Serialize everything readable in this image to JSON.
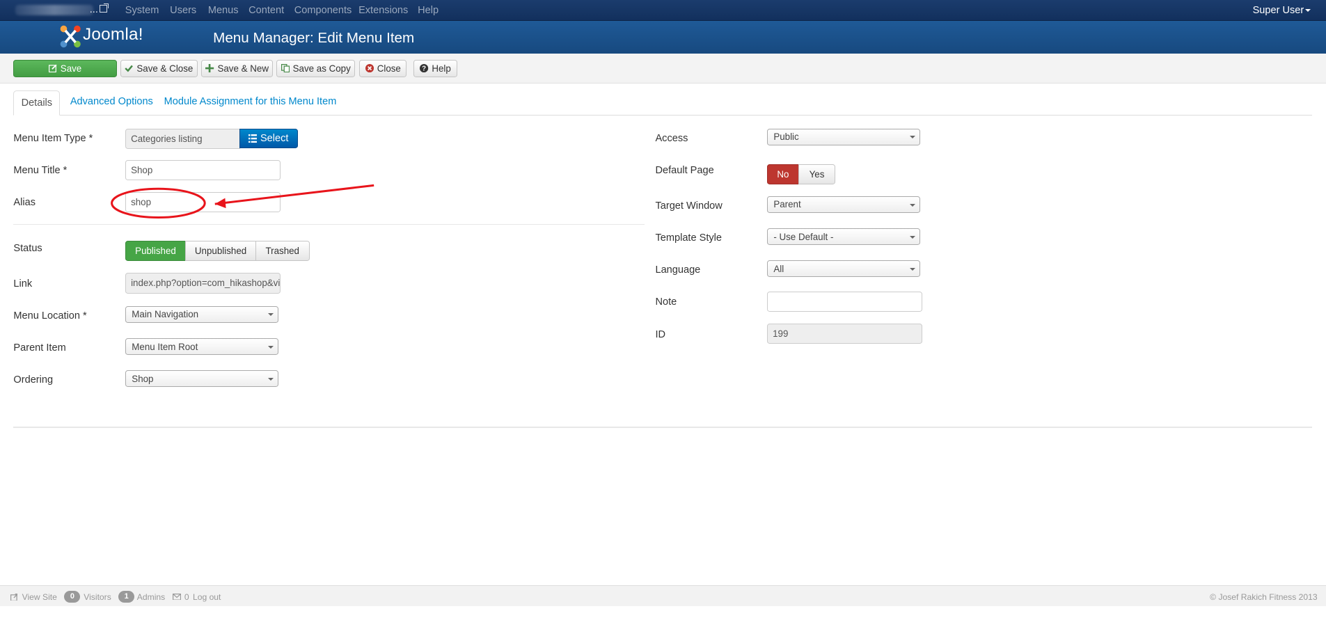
{
  "navbar": {
    "site_dots": "...",
    "menu": [
      "System",
      "Users",
      "Menus",
      "Content",
      "Components",
      "Extensions",
      "Help"
    ],
    "user": "Super User"
  },
  "header": {
    "logo": "Joomla!",
    "title": "Menu Manager: Edit Menu Item"
  },
  "toolbar": {
    "save": "Save",
    "save_close": "Save & Close",
    "save_new": "Save & New",
    "save_copy": "Save as Copy",
    "close": "Close",
    "help": "Help"
  },
  "tabs": [
    "Details",
    "Advanced Options",
    "Module Assignment for this Menu Item"
  ],
  "left": {
    "menu_item_type": {
      "label": "Menu Item Type *",
      "value": "Categories listing",
      "button": "Select"
    },
    "menu_title": {
      "label": "Menu Title *",
      "value": "Shop"
    },
    "alias": {
      "label": "Alias",
      "value": "shop"
    },
    "status": {
      "label": "Status",
      "options": [
        "Published",
        "Unpublished",
        "Trashed"
      ],
      "selected": "Published"
    },
    "link": {
      "label": "Link",
      "value": "index.php?option=com_hikashop&vi"
    },
    "menu_location": {
      "label": "Menu Location *",
      "value": "Main Navigation"
    },
    "parent_item": {
      "label": "Parent Item",
      "value": "Menu Item Root"
    },
    "ordering": {
      "label": "Ordering",
      "value": "Shop"
    }
  },
  "right": {
    "access": {
      "label": "Access",
      "value": "Public"
    },
    "default_page": {
      "label": "Default Page",
      "options": [
        "No",
        "Yes"
      ],
      "selected": "No"
    },
    "target_window": {
      "label": "Target Window",
      "value": "Parent"
    },
    "template_style": {
      "label": "Template Style",
      "value": "- Use Default -"
    },
    "language": {
      "label": "Language",
      "value": "All"
    },
    "note": {
      "label": "Note",
      "value": ""
    },
    "id": {
      "label": "ID",
      "value": "199"
    }
  },
  "footer": {
    "view_site": "View Site",
    "visitors_count": "0",
    "visitors": "Visitors",
    "admins_count": "1",
    "admins": "Admins",
    "messages_count": "0",
    "logout": "Log out",
    "copyright": "© Josef Rakich Fitness 2013"
  },
  "colors": {
    "navbar": "#1b3c6d",
    "header": "#1f5a97",
    "save": "#46a546",
    "annotation": "#e8141b",
    "link": "#0088cc"
  }
}
